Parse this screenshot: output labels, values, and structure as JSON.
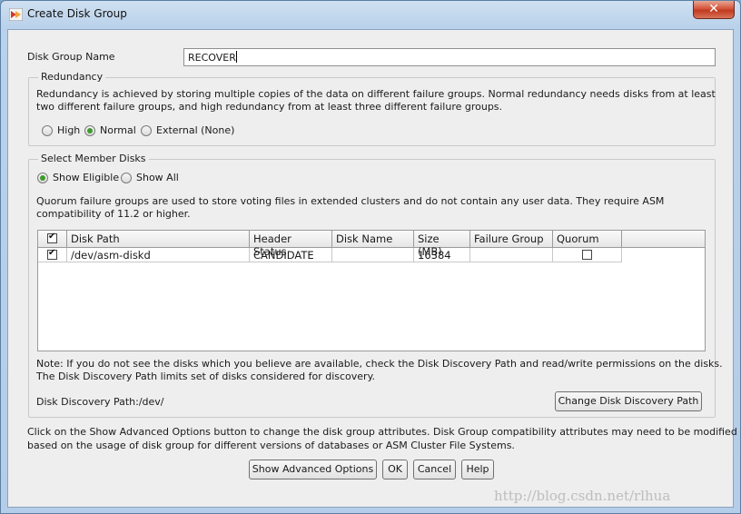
{
  "window": {
    "title": "Create Disk Group",
    "close_glyph": "✕"
  },
  "disk_group_name": {
    "label": "Disk Group Name",
    "value": "RECOVER"
  },
  "redundancy": {
    "legend": "Redundancy",
    "description_line1": "Redundancy is achieved by storing multiple copies of the data on different failure groups. Normal redundancy needs disks from at least",
    "description_line2": "two different failure groups, and high redundancy from at least three different failure groups.",
    "options": [
      "High",
      "Normal",
      "External (None)"
    ],
    "selected": "Normal"
  },
  "member_disks": {
    "legend": "Select Member Disks",
    "filter_options": [
      "Show Eligible",
      "Show All"
    ],
    "selected_filter": "Show Eligible",
    "quorum_note_line1": "Quorum failure groups are used to store voting files in extended clusters and do not contain any user data. They require ASM",
    "quorum_note_line2": "compatibility of 11.2 or higher.",
    "table": {
      "columns": [
        "Disk Path",
        "Header Status",
        "Disk Name",
        "Size (MB)",
        "Failure Group",
        "Quorum"
      ],
      "header_checked": true,
      "rows": [
        {
          "checked": true,
          "disk_path": "/dev/asm-diskd",
          "header_status": "CANDIDATE",
          "disk_name": "",
          "size_mb": "16384",
          "failure_group": "",
          "quorum": false
        }
      ]
    },
    "note_line1": "Note: If you do not see the disks which you believe are available, check the Disk Discovery Path and read/write permissions on the disks.",
    "note_line2": "The Disk Discovery Path limits set of disks considered for discovery.",
    "discovery_path": "Disk Discovery Path:/dev/",
    "change_path_button": "Change Disk Discovery Path"
  },
  "advanced_hint_line1": "Click on the Show Advanced Options button to change the disk group attributes. Disk Group compatibility attributes may need to be modified",
  "advanced_hint_line2": "based on the usage of disk group for different versions of databases or ASM Cluster File Systems.",
  "buttons": {
    "advanced": "Show Advanced Options",
    "ok": "OK",
    "cancel": "Cancel",
    "help": "Help"
  },
  "watermark": "http://blog.csdn.net/rlhua"
}
